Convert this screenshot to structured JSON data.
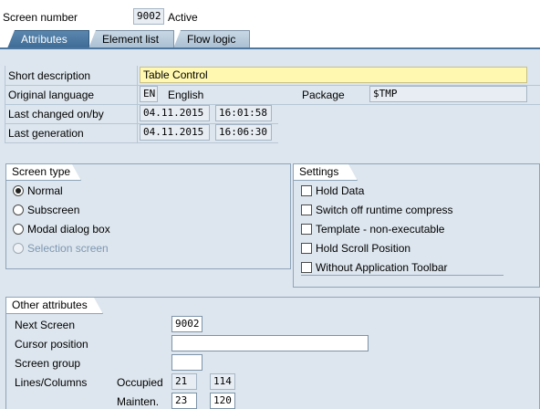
{
  "header": {
    "screen_number_label": "Screen number",
    "screen_number": "9002",
    "status": "Active"
  },
  "tabs": [
    {
      "label": "Attributes",
      "active": true
    },
    {
      "label": "Element list",
      "active": false
    },
    {
      "label": "Flow logic",
      "active": false
    }
  ],
  "attributes": {
    "short_desc_label": "Short description",
    "short_desc": "Table Control",
    "orig_lang_label": "Original language",
    "orig_lang_code": "EN",
    "orig_lang_name": "English",
    "package_label": "Package",
    "package": "$TMP",
    "last_changed_label": "Last changed on/by",
    "last_changed_date": "04.11.2015",
    "last_changed_time": "16:01:58",
    "last_gen_label": "Last generation",
    "last_gen_date": "04.11.2015",
    "last_gen_time": "16:06:30"
  },
  "screen_type": {
    "title": "Screen type",
    "options": [
      {
        "label": "Normal",
        "selected": true,
        "disabled": false
      },
      {
        "label": "Subscreen",
        "selected": false,
        "disabled": false
      },
      {
        "label": "Modal dialog box",
        "selected": false,
        "disabled": false
      },
      {
        "label": "Selection screen",
        "selected": false,
        "disabled": true
      }
    ]
  },
  "settings": {
    "title": "Settings",
    "options": [
      {
        "label": "Hold Data",
        "checked": false
      },
      {
        "label": "Switch off runtime compress",
        "checked": false
      },
      {
        "label": "Template - non-executable",
        "checked": false
      },
      {
        "label": "Hold Scroll Position",
        "checked": false
      },
      {
        "label": "Without Application Toolbar",
        "checked": false
      }
    ]
  },
  "other": {
    "title": "Other attributes",
    "next_screen_label": "Next Screen",
    "next_screen": "9002",
    "cursor_label": "Cursor position",
    "cursor": "",
    "group_label": "Screen group",
    "group": "",
    "lines_cols_label": "Lines/Columns",
    "occupied_label": "Occupied",
    "occupied_lines": "21",
    "occupied_cols": "114",
    "mainten_label": "Mainten.",
    "mainten_lines": "23",
    "mainten_cols": "120"
  },
  "colors": {
    "tab_active": "#3d6b95",
    "panel_bg": "#dde6ee",
    "desc_field": "#fff8b0"
  }
}
